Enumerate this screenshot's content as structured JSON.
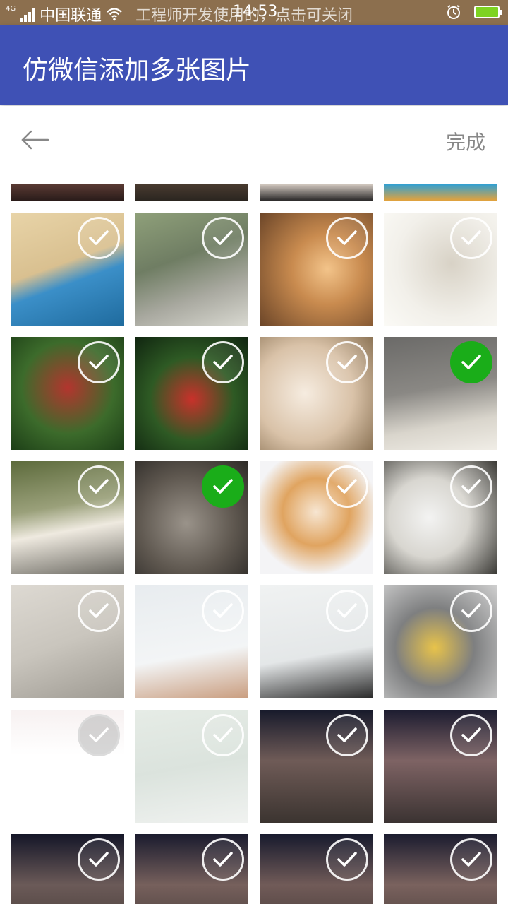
{
  "status_bar": {
    "carrier": "中国联通",
    "network": "4G",
    "notice": "工程师开发使用的，点击可关闭",
    "time": "14:53"
  },
  "toolbar": {
    "title": "仿微信添加多张图片"
  },
  "subbar": {
    "done_label": "完成"
  },
  "photos": [
    {
      "desc": "top-partial-1",
      "selected": false
    },
    {
      "desc": "top-partial-2",
      "selected": false
    },
    {
      "desc": "top-partial-3",
      "selected": false
    },
    {
      "desc": "top-partial-4",
      "selected": false
    },
    {
      "desc": "menu-sign",
      "selected": false
    },
    {
      "desc": "yellow-bicycle",
      "selected": false
    },
    {
      "desc": "cat-on-wooden-floor",
      "selected": false
    },
    {
      "desc": "cat-sketch",
      "selected": false
    },
    {
      "desc": "lychee-tree",
      "selected": false
    },
    {
      "desc": "lychee-close",
      "selected": false
    },
    {
      "desc": "cat-paws",
      "selected": false
    },
    {
      "desc": "grey-cat-lying",
      "selected": true
    },
    {
      "desc": "white-cat-outside",
      "selected": false
    },
    {
      "desc": "grey-cat-face",
      "selected": true
    },
    {
      "desc": "orange-white-cat",
      "selected": false
    },
    {
      "desc": "desk-fan",
      "selected": false
    },
    {
      "desc": "glass-of-water",
      "selected": false
    },
    {
      "desc": "floor-plan-1",
      "selected": false
    },
    {
      "desc": "floor-plan-2",
      "selected": false
    },
    {
      "desc": "bowl-of-food",
      "selected": false
    },
    {
      "desc": "documents-stamps",
      "selected": false
    },
    {
      "desc": "screen-photo",
      "selected": false
    },
    {
      "desc": "group-night-1",
      "selected": false
    },
    {
      "desc": "group-night-2",
      "selected": false
    },
    {
      "desc": "group-night-3",
      "selected": false
    },
    {
      "desc": "group-night-4",
      "selected": false
    },
    {
      "desc": "group-night-5",
      "selected": false
    },
    {
      "desc": "group-night-6",
      "selected": false
    }
  ],
  "colors": {
    "toolbar": "#3f51b5",
    "status_bar": "#8c6f4e",
    "selected": "#1aad19"
  }
}
